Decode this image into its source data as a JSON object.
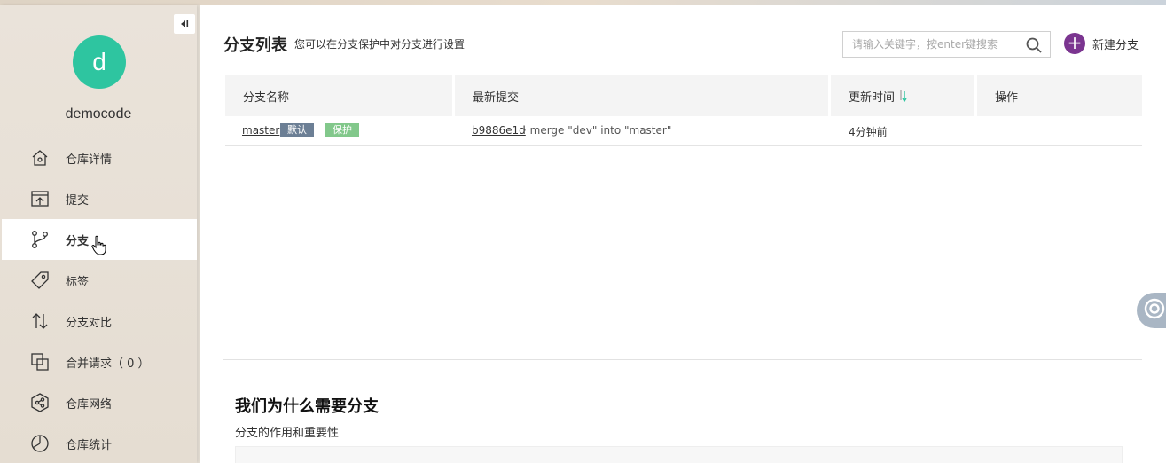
{
  "sidebar": {
    "collapse_icon": "collapse-left-icon",
    "avatar_letter": "d",
    "avatar_color": "#2ec5a0",
    "repo_name": "democode",
    "items": [
      {
        "label": "仓库详情",
        "icon": "repo-home-icon",
        "active": false
      },
      {
        "label": "提交",
        "icon": "commit-upload-icon",
        "active": false
      },
      {
        "label": "分支",
        "icon": "branch-icon",
        "active": true
      },
      {
        "label": "标签",
        "icon": "tag-icon",
        "active": false
      },
      {
        "label": "分支对比",
        "icon": "compare-icon",
        "active": false
      },
      {
        "label": "合并请求（ 0 ）",
        "icon": "merge-request-icon",
        "active": false
      },
      {
        "label": "仓库网络",
        "icon": "network-icon",
        "active": false
      },
      {
        "label": "仓库统计",
        "icon": "stats-icon",
        "active": false
      }
    ]
  },
  "header": {
    "title": "分支列表",
    "subtitle": "您可以在分支保护中对分支进行设置"
  },
  "search": {
    "placeholder": "请输入关键字，按enter键搜索",
    "value": ""
  },
  "new_branch": {
    "label": "新建分支",
    "accent": "#7b3590"
  },
  "table": {
    "columns": [
      "分支名称",
      "最新提交",
      "更新时间",
      "操作"
    ],
    "rows": [
      {
        "branch": "master",
        "badges": [
          {
            "text": "默认",
            "color": "#6c7f95"
          },
          {
            "text": "保护",
            "color": "#82c88b"
          }
        ],
        "commit_id": "b9886e1d",
        "commit_message": "· merge \"dev\" into \"master\"",
        "updated": "4分钟前"
      }
    ]
  },
  "why_section": {
    "title": "我们为什么需要分支",
    "subtitle": "分支的作用和重要性"
  }
}
